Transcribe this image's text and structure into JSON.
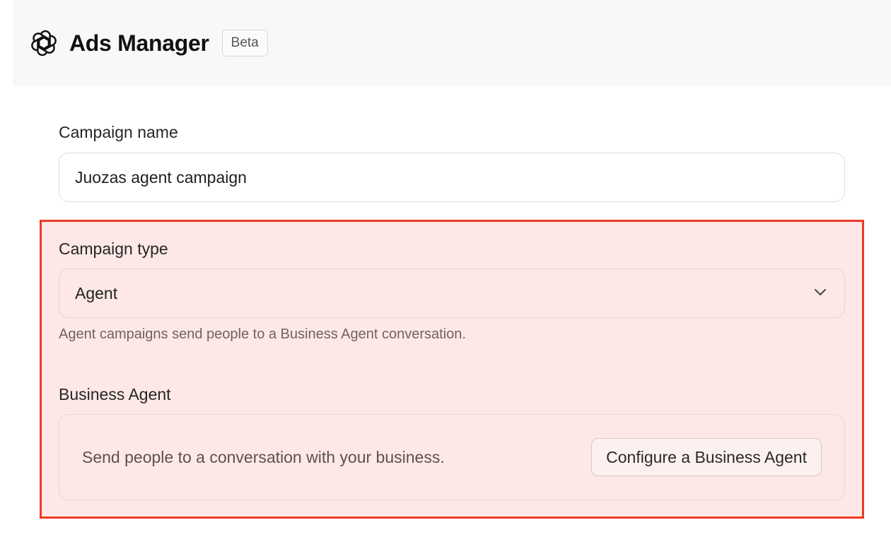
{
  "header": {
    "logo_icon": "openai-knot-icon",
    "app_title": "Ads Manager",
    "badge": "Beta"
  },
  "form": {
    "campaign_name": {
      "label": "Campaign name",
      "value": "Juozas agent campaign"
    },
    "campaign_type": {
      "label": "Campaign type",
      "selected": "Agent",
      "dropdown_icon": "chevron-down-icon",
      "helper": "Agent campaigns send people to a Business Agent conversation."
    },
    "business_agent": {
      "label": "Business Agent",
      "description": "Send people to a conversation with your business.",
      "button_label": "Configure a Business Agent"
    }
  },
  "colors": {
    "highlight_border": "#ec3a26",
    "highlight_fill": "#fee8e5",
    "header_bg": "#f8f8f7"
  }
}
